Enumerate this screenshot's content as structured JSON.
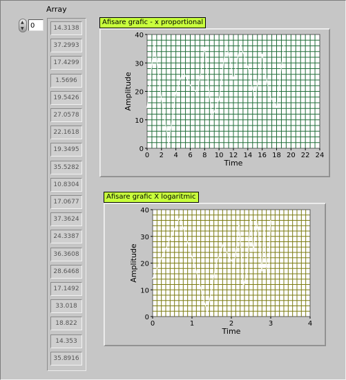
{
  "array": {
    "label": "Array",
    "index": "0",
    "values": [
      "14.3138",
      "37.2993",
      "17.4299",
      "1.5696",
      "19.5426",
      "27.0578",
      "22.1618",
      "19.3495",
      "35.5282",
      "10.8304",
      "17.0677",
      "37.3624",
      "24.3387",
      "36.3608",
      "28.6468",
      "17.1492",
      "33.018",
      "18.822",
      "14.353",
      "35.8916"
    ]
  },
  "graph1": {
    "title": "Afisare grafic - x proportional",
    "title_bg": "#c8ff3c",
    "plot_bg": "#ffffff",
    "grid_color": "#1e6b37",
    "xlabel": "Time",
    "ylabel": "Amplitude",
    "x_ticks": [
      "0",
      "2",
      "4",
      "6",
      "8",
      "10",
      "12",
      "14",
      "16",
      "18",
      "20",
      "22",
      "24"
    ],
    "y_ticks": [
      "0",
      "10",
      "20",
      "30",
      "40"
    ]
  },
  "graph2": {
    "title": "Afisare grafic X logaritmic",
    "title_bg": "#c8ff3c",
    "plot_bg": "#ffffff",
    "grid_color": "#7a7a10",
    "xlabel": "Time",
    "ylabel": "Amplitude",
    "x_ticks": [
      "0",
      "1",
      "2",
      "3",
      "4"
    ],
    "y_ticks": [
      "0",
      "10",
      "20",
      "30",
      "40"
    ]
  },
  "chart_data": [
    {
      "type": "line",
      "title": "Afisare grafic - x proportional",
      "xlabel": "Time",
      "ylabel": "Amplitude",
      "xlim": [
        0,
        24
      ],
      "ylim": [
        0,
        40
      ],
      "x": [
        0,
        1,
        2,
        3,
        4,
        5,
        6,
        7,
        8,
        9,
        10,
        11,
        12,
        13,
        14,
        15,
        16,
        17,
        18,
        19
      ],
      "values": [
        14.3138,
        37.2993,
        17.4299,
        1.5696,
        19.5426,
        27.0578,
        22.1618,
        19.3495,
        35.5282,
        10.8304,
        17.0677,
        37.3624,
        24.3387,
        36.3608,
        28.6468,
        17.1492,
        33.018,
        18.822,
        14.353,
        35.8916
      ],
      "series_color": "#ffffff"
    },
    {
      "type": "line",
      "title": "Afisare grafic X logaritmic",
      "xlabel": "Time",
      "ylabel": "Amplitude",
      "xlim": [
        0,
        4
      ],
      "ylim": [
        0,
        40
      ],
      "x": [
        0.0,
        0.693,
        1.099,
        1.386,
        1.609,
        1.792,
        1.946,
        2.079,
        2.197,
        2.303,
        2.398,
        2.485,
        2.565,
        2.639,
        2.708,
        2.773,
        2.833,
        2.89,
        2.944,
        2.996
      ],
      "values": [
        14.3138,
        37.2993,
        17.4299,
        1.5696,
        19.5426,
        27.0578,
        22.1618,
        19.3495,
        35.5282,
        10.8304,
        17.0677,
        37.3624,
        24.3387,
        36.3608,
        28.6468,
        17.1492,
        33.018,
        18.822,
        14.353,
        35.8916
      ],
      "series_color": "#ffffff"
    }
  ]
}
